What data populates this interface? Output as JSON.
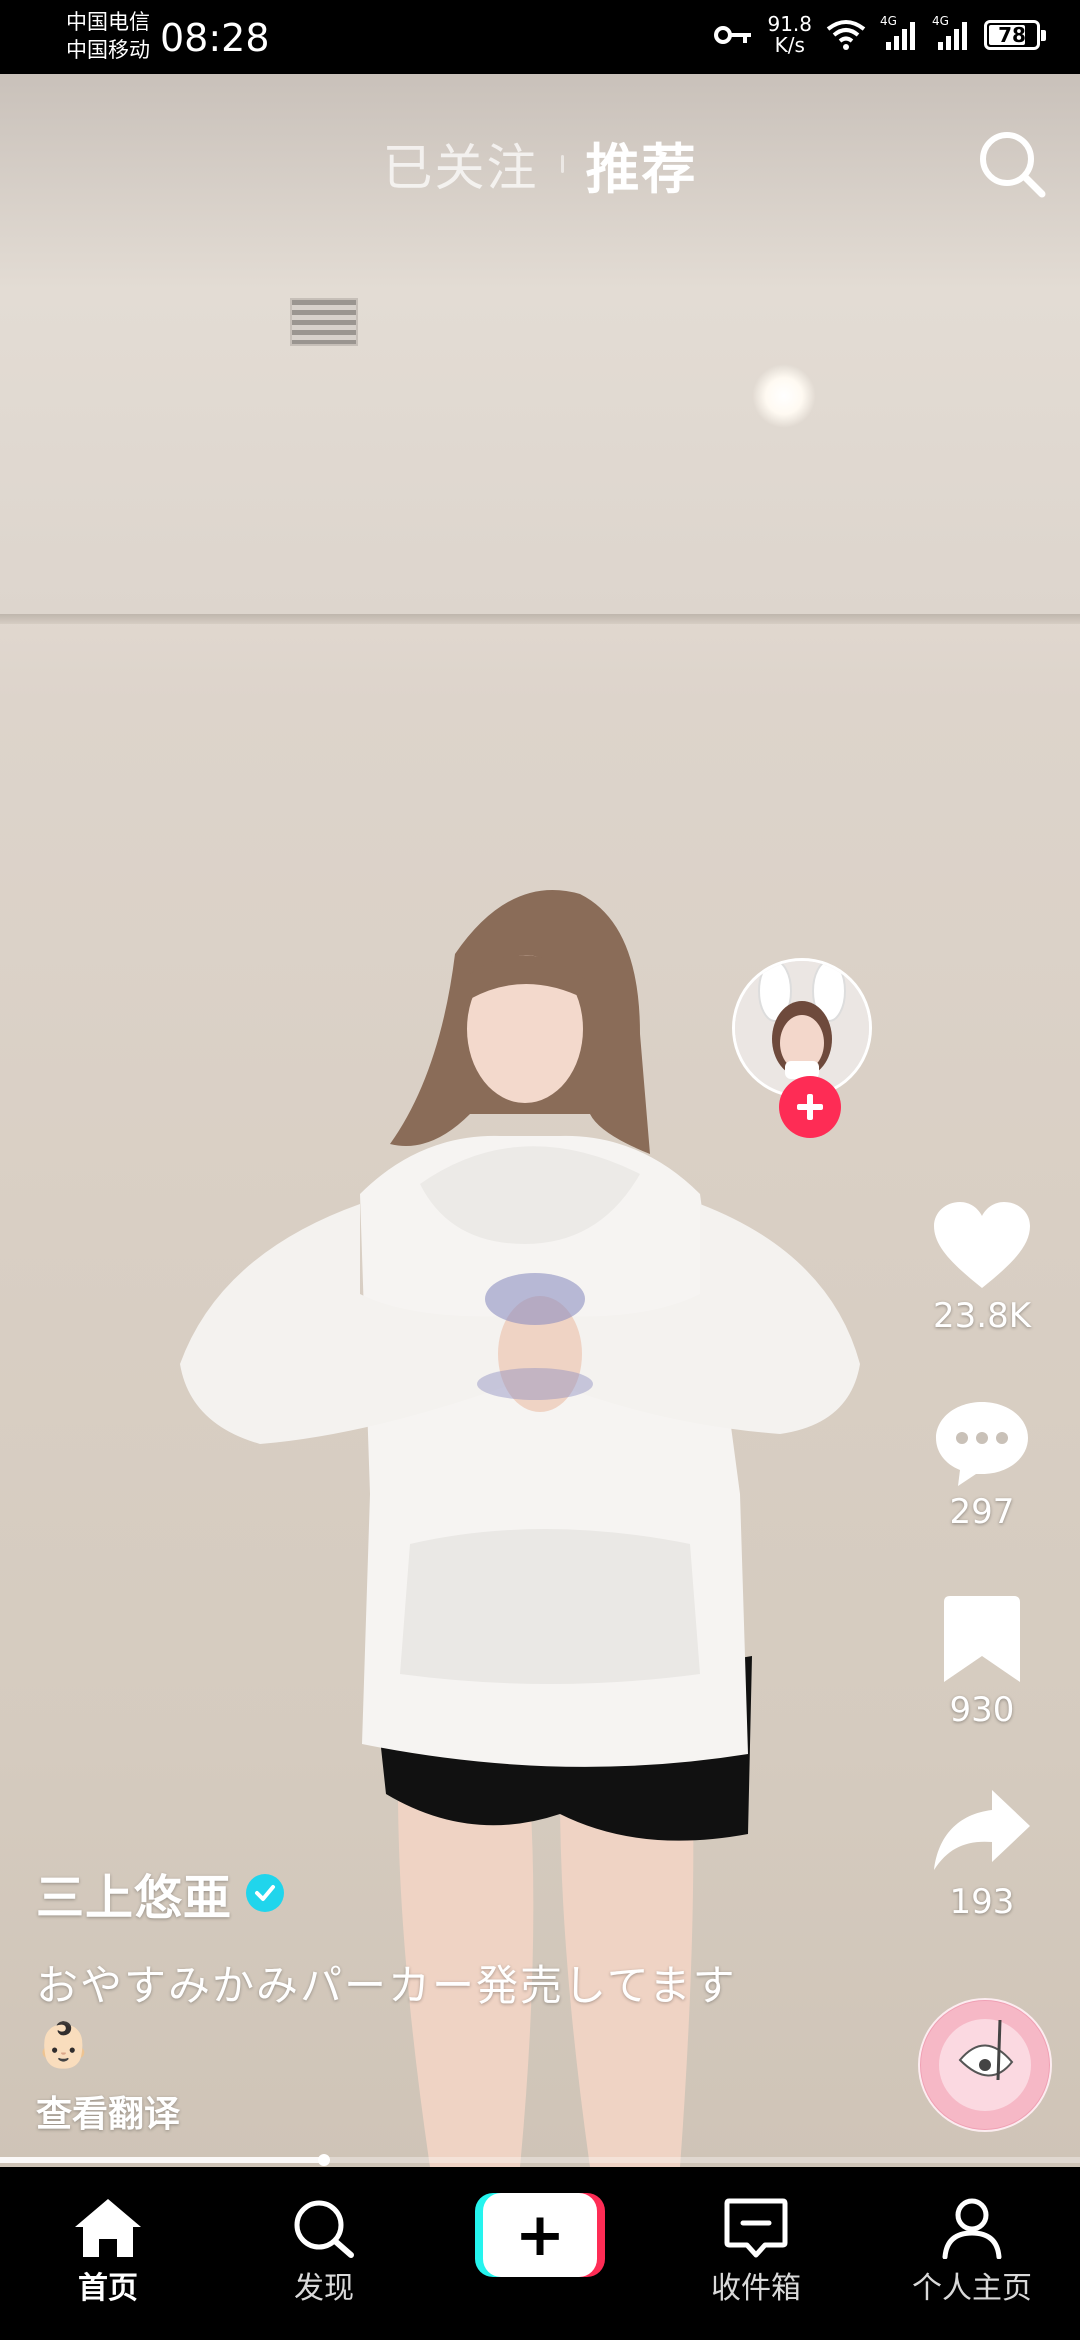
{
  "status_bar": {
    "carrier_1": "中国电信",
    "carrier_2": "中国移动",
    "time": "08:28",
    "net_speed_value": "91.8",
    "net_speed_unit": "K/s",
    "signal_1_label": "4G",
    "signal_2_label": "4G",
    "battery_level": "78",
    "icons": [
      "key-icon",
      "wifi-icon",
      "signal-icon",
      "battery-icon"
    ]
  },
  "top_tabs": {
    "following": "已关注",
    "recommend": "推荐",
    "active": "recommend"
  },
  "actions": {
    "like_count": "23.8K",
    "comment_count": "297",
    "favorite_count": "930",
    "share_count": "193"
  },
  "post": {
    "author": "三上悠亜",
    "description": "おやすみかみパーカー発売してます",
    "emoji": "👶🏻",
    "translate_label": "查看翻译"
  },
  "progress_fraction": 0.3,
  "bottom_nav": {
    "home": "首页",
    "discover": "发现",
    "create_symbol": "+",
    "inbox": "收件箱",
    "profile": "个人主页",
    "active": "home"
  },
  "colors": {
    "accent_red": "#fe2c55",
    "accent_cyan": "#25f4ee",
    "verified_blue": "#20d5ec"
  }
}
